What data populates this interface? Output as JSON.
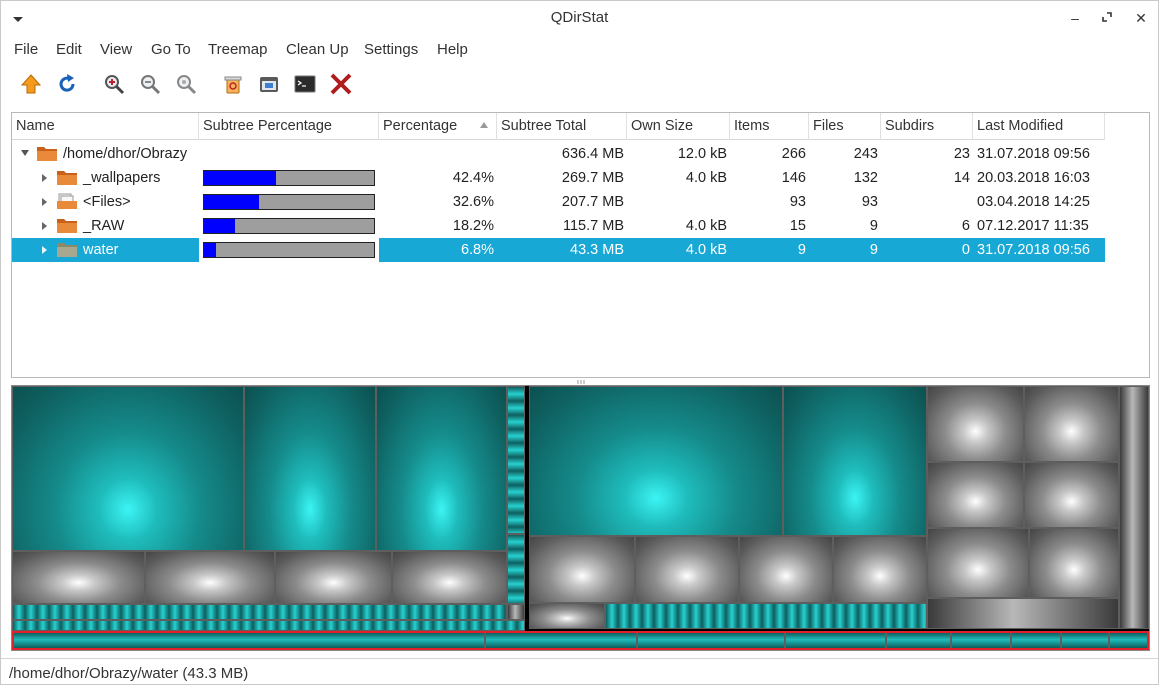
{
  "window": {
    "title": "QDirStat"
  },
  "menu": [
    "File",
    "Edit",
    "View",
    "Go To",
    "Treemap",
    "Clean Up",
    "Settings",
    "Help"
  ],
  "toolbar": [
    "go-up-icon",
    "refresh-icon",
    "zoom-in-icon",
    "zoom-out-icon",
    "zoom-reset-icon",
    "move-to-trash-icon",
    "open-file-manager-icon",
    "open-terminal-icon",
    "delete-icon"
  ],
  "columns": [
    "Name",
    "Subtree Percentage",
    "Percentage",
    "Subtree Total",
    "Own Size",
    "Items",
    "Files",
    "Subdirs",
    "Last Modified"
  ],
  "rows": [
    {
      "name": "/home/dhor/Obrazy",
      "percent": "",
      "percent_value": null,
      "subtree_total": "636.4 MB",
      "own_size": "12.0 kB",
      "items": "266",
      "files": "243",
      "subdirs": "23",
      "modified": "31.07.2018 09:56"
    },
    {
      "name": "_wallpapers",
      "percent": "42.4%",
      "percent_value": 42.4,
      "subtree_total": "269.7 MB",
      "own_size": "4.0 kB",
      "items": "146",
      "files": "132",
      "subdirs": "14",
      "modified": "20.03.2018 16:03"
    },
    {
      "name": "<Files>",
      "percent": "32.6%",
      "percent_value": 32.6,
      "subtree_total": "207.7 MB",
      "own_size": "",
      "items": "93",
      "files": "93",
      "subdirs": "",
      "modified": "03.04.2018 14:25"
    },
    {
      "name": "_RAW",
      "percent": "18.2%",
      "percent_value": 18.2,
      "subtree_total": "115.7 MB",
      "own_size": "4.0 kB",
      "items": "15",
      "files": "9",
      "subdirs": "6",
      "modified": "07.12.2017 11:35"
    },
    {
      "name": "water",
      "percent": "6.8%",
      "percent_value": 6.8,
      "subtree_total": "43.3 MB",
      "own_size": "4.0 kB",
      "items": "9",
      "files": "9",
      "subdirs": "0",
      "modified": "31.07.2018 09:56"
    }
  ],
  "status": {
    "text": "/home/dhor/Obrazy/water  (43.3 MB)"
  },
  "colors": {
    "selection": "#18a8d6",
    "bar_fill": "#0000ff",
    "bar_bg": "#9e9e9e",
    "treemap_highlight": "#e0202a",
    "folder": "#e07a2a"
  }
}
